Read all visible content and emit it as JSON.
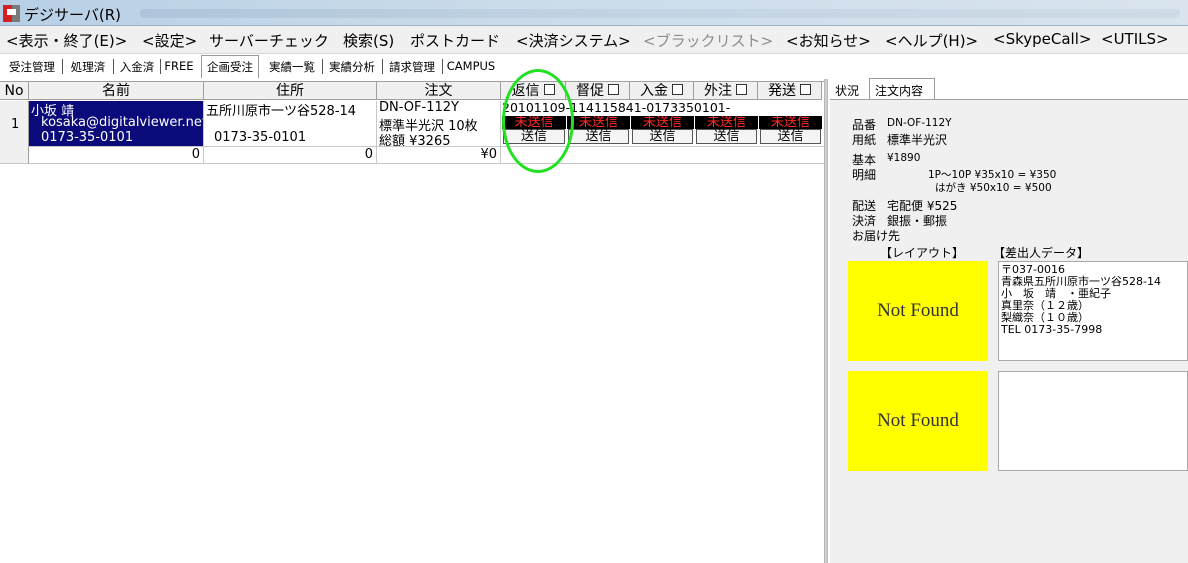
{
  "window": {
    "title": "デジサーバ(R)"
  },
  "menu": [
    "<表示・終了(E)>",
    "<設定>",
    "サーバーチェック",
    "検索(S)",
    "ポストカード",
    "<決済システム>",
    "<ブラックリスト>",
    "<お知らせ>",
    "<ヘルプ(H)>",
    "<SkypeCall>",
    "<UTILS>"
  ],
  "tabs": [
    "受注管理",
    "処理済",
    "入金済",
    "FREE",
    "企画受注",
    "実績一覧",
    "実績分析",
    "請求管理",
    "CAMPUS"
  ],
  "active_tab": "企画受注",
  "grid": {
    "headers": {
      "no": "No",
      "name": "名前",
      "address": "住所",
      "order": "注文",
      "reply": "返信",
      "remind": "督促",
      "payment": "入金",
      "outsource": "外注",
      "ship": "発送"
    },
    "row": {
      "no": "1",
      "name_line1": "小坂 靖",
      "name_line2": "kosaka@digitalviewer.net",
      "name_line3": "0173-35-0101",
      "address_line1": "五所川原市一ツ谷528-14",
      "address_line2": "0173-35-0101",
      "order_line1": "DN-OF-112Y",
      "order_line2": "標準半光沢 10枚",
      "order_line3": "総額 ¥3265",
      "order_id": "20101109-114115841-0173350101-",
      "status_unsent": "未送信",
      "send_label": "送信"
    },
    "totals": {
      "name": "0",
      "address": "0",
      "order": "¥0"
    }
  },
  "right_panel": {
    "tabs": [
      "状況",
      "注文内容"
    ],
    "active_tab": "注文内容",
    "product_label": "品番",
    "product_value": "DN-OF-112Y",
    "paper_label": "用紙",
    "paper_value": "標準半光沢",
    "base_label": "基本",
    "base_value": "¥1890",
    "detail_label": "明細",
    "detail_line1": "1P～10P ¥35x10 = ¥350",
    "detail_line2": "はがき ¥50x10 = ¥500",
    "delivery_label": "配送",
    "delivery_value": "宅配便 ¥525",
    "payment_label": "決済",
    "payment_value": "銀振・郵振",
    "dest_label": "お届け先",
    "layout_header": "【レイアウト】",
    "sender_header": "【差出人データ】",
    "not_found": "Not Found",
    "sender_lines": [
      "〒037-0016",
      "青森県五所川原市一ツ谷528-14",
      "小　坂　靖　・亜紀子",
      "真里奈（１２歳）",
      "梨織奈（１０歳）",
      "TEL 0173-35-7998"
    ]
  },
  "colors": {
    "selected": "#0a0a7a",
    "unsent_text": "#ff2a2a",
    "highlight_ring": "#22e022",
    "not_found_bg": "#ffff00"
  }
}
